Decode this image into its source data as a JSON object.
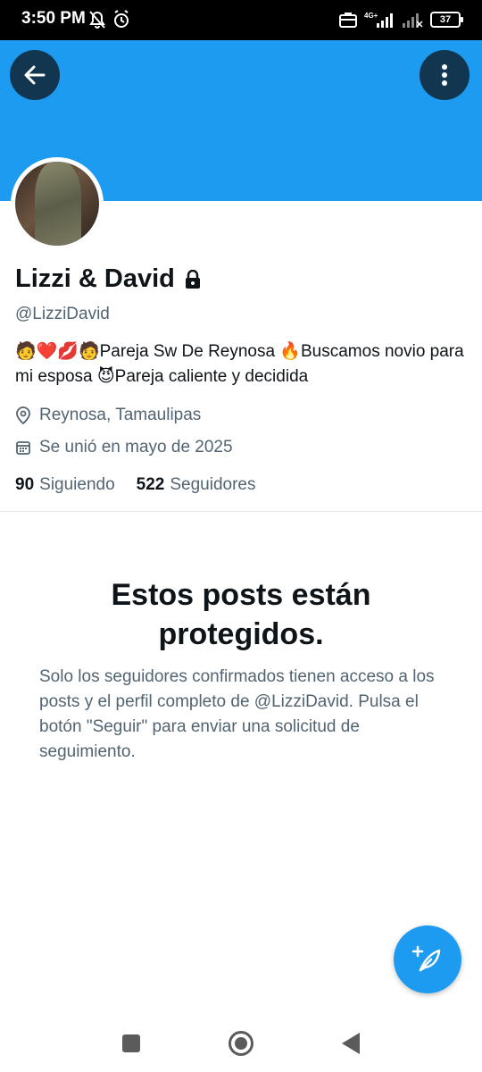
{
  "status_bar": {
    "time": "3:50 PM",
    "network": "4G+",
    "battery": "37",
    "icons": [
      "mute-bell-icon",
      "alarm-icon",
      "briefcase-icon",
      "signal-icon",
      "no-signal-icon",
      "battery-icon"
    ]
  },
  "header": {
    "back_icon": "arrow-left-icon",
    "more_icon": "more-vertical-icon",
    "banner_color": "#1d9bf0"
  },
  "profile": {
    "display_name": "Lizzi & David",
    "lock_icon": "lock-icon",
    "handle": "@LizziDavid",
    "bio": "🧑❤️💋🧑Pareja Sw De Reynosa 🔥Buscamos novio para mi esposa 😈Pareja caliente y decidida",
    "location": "Reynosa, Tamaulipas",
    "joined": "Se unió en mayo de 2025",
    "following_count": "90",
    "following_label": "Siguiendo",
    "followers_count": "522",
    "followers_label": "Seguidores"
  },
  "protected": {
    "title": "Estos posts están protegidos.",
    "description": "Solo los seguidores confirmados tienen acceso a los posts y el perfil completo de @LizziDavid. Pulsa el botón \"Seguir\" para enviar una solicitud de seguimiento."
  },
  "fab": {
    "icon": "compose-post-icon",
    "color": "#1d9bf0"
  },
  "nav": {
    "icons": [
      "recents-icon",
      "home-icon",
      "back-icon"
    ]
  }
}
